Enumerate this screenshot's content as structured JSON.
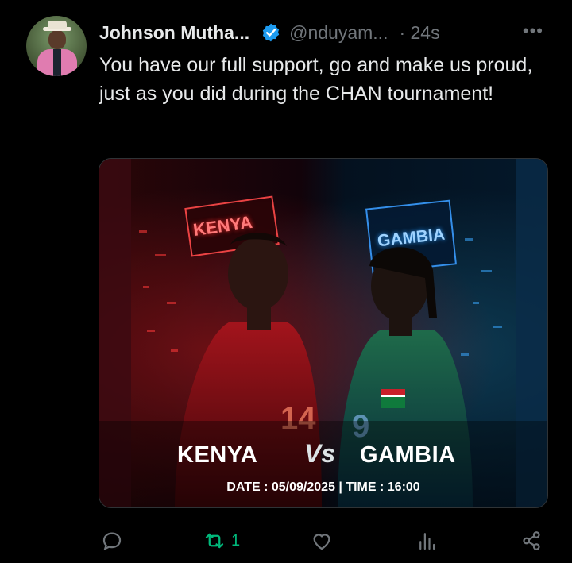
{
  "tweet": {
    "author_name": "Johnson Mutha...",
    "author_handle": "@nduyam...",
    "time": "· 24s",
    "more_label": "•••",
    "text": "You have our full support, go and make us proud, just as you did during the CHAN tournament!"
  },
  "media": {
    "sign_left": "KENYA",
    "sign_right": "GAMBIA",
    "team_left": "KENYA",
    "vs_label": "Vs",
    "team_right": "GAMBIA",
    "date_time": "DATE : 05/09/2025 | TIME : 16:00",
    "jersey_left_number": "14",
    "jersey_right_number": "9"
  },
  "actions": {
    "reply_count": "",
    "retweet_count": "1",
    "like_count": "",
    "views_count": ""
  },
  "colors": {
    "background": "#000000",
    "text": "#e7e9ea",
    "muted": "#71767b",
    "verified": "#1d9bf0",
    "retweet_active": "#00ba7c"
  }
}
